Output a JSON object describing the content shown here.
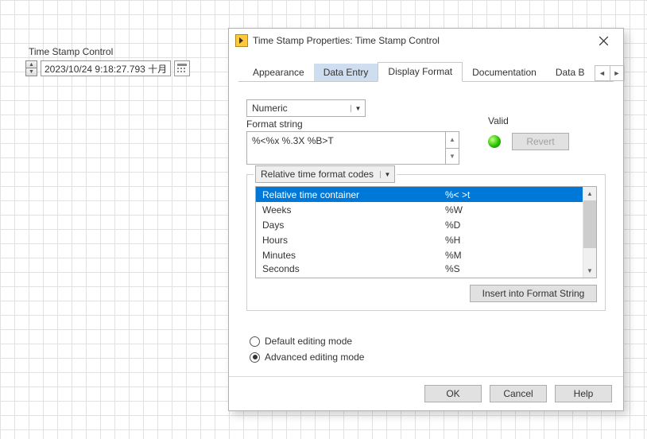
{
  "fp": {
    "label": "Time Stamp Control",
    "value": "2023/10/24 9:18:27.793 十月"
  },
  "dlg": {
    "title": "Time Stamp Properties: Time Stamp Control",
    "tabs": {
      "appearance": "Appearance",
      "data_entry": "Data Entry",
      "display_format": "Display Format",
      "documentation": "Documentation",
      "data_b": "Data B"
    },
    "type_drop": "Numeric",
    "fmt_label": "Format string",
    "fmt_value": "%<%x %.3X %B>T",
    "valid_label": "Valid",
    "revert": "Revert",
    "codes_drop": "Relative time format codes",
    "codes": [
      {
        "name": "Relative time container",
        "code": "%< >t"
      },
      {
        "name": "Weeks",
        "code": "%W"
      },
      {
        "name": "Days",
        "code": "%D"
      },
      {
        "name": "Hours",
        "code": "%H"
      },
      {
        "name": "Minutes",
        "code": "%M"
      },
      {
        "name": "Seconds",
        "code": "%S"
      }
    ],
    "insert": "Insert into Format String",
    "radio": {
      "default": "Default editing mode",
      "advanced": "Advanced editing mode"
    },
    "buttons": {
      "ok": "OK",
      "cancel": "Cancel",
      "help": "Help"
    }
  }
}
